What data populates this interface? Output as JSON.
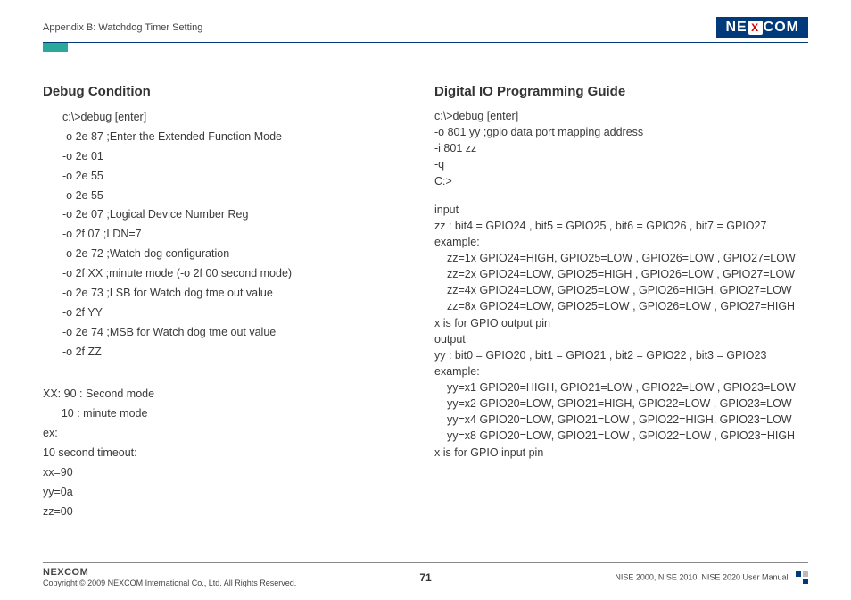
{
  "header": {
    "appendix": "Appendix B: Watchdog Timer Setting",
    "logo_pre": "NE",
    "logo_x": "X",
    "logo_post": "COM"
  },
  "left": {
    "title": "Debug Condition",
    "lines": [
      "c:\\>debug [enter]",
      "-o 2e 87 ;Enter the Extended Function Mode",
      "-o 2e 01",
      "-o 2e 55",
      "-o 2e 55",
      "-o 2e 07 ;Logical Device Number Reg",
      "-o 2f 07 ;LDN=7",
      "-o 2e 72 ;Watch dog configuration",
      "-o 2f XX ;minute mode (-o 2f 00 second mode)",
      "-o 2e 73 ;LSB for Watch dog tme out value",
      "-o 2f YY",
      "-o 2e 74 ;MSB for Watch dog tme out value",
      "-o 2f ZZ"
    ],
    "notes": [
      "XX: 90 : Second mode",
      "      10 : minute mode",
      "ex:",
      "10 second timeout:",
      "xx=90",
      "yy=0a",
      "zz=00"
    ]
  },
  "right": {
    "title": "Digital IO Programming Guide",
    "lines1": [
      "c:\\>debug [enter]",
      "-o 801 yy ;gpio data port mapping address",
      "-i 801 zz",
      "-q",
      "C:>"
    ],
    "input_label": "input",
    "zz_def": "zz : bit4 = GPIO24 , bit5 = GPIO25 , bit6 = GPIO26 , bit7 = GPIO27",
    "example_label": "example:",
    "zz_examples": [
      "zz=1x  GPIO24=HIGH, GPIO25=LOW , GPIO26=LOW , GPIO27=LOW",
      "zz=2x  GPIO24=LOW, GPIO25=HIGH , GPIO26=LOW , GPIO27=LOW",
      "zz=4x  GPIO24=LOW, GPIO25=LOW , GPIO26=HIGH, GPIO27=LOW",
      "zz=8x  GPIO24=LOW, GPIO25=LOW , GPIO26=LOW , GPIO27=HIGH"
    ],
    "x_out": "x is for GPIO output pin",
    "output_label": "output",
    "yy_def": "yy : bit0 = GPIO20 , bit1 = GPIO21 , bit2 = GPIO22 , bit3 = GPIO23",
    "yy_examples": [
      "yy=x1  GPIO20=HIGH, GPIO21=LOW , GPIO22=LOW , GPIO23=LOW",
      "yy=x2  GPIO20=LOW, GPIO21=HIGH, GPIO22=LOW , GPIO23=LOW",
      "yy=x4  GPIO20=LOW, GPIO21=LOW , GPIO22=HIGH, GPIO23=LOW",
      "yy=x8  GPIO20=LOW, GPIO21=LOW , GPIO22=LOW , GPIO23=HIGH"
    ],
    "x_in": "x is for GPIO input pin"
  },
  "footer": {
    "logo": "NEXCOM",
    "copyright": "Copyright © 2009 NEXCOM International Co., Ltd. All Rights Reserved.",
    "page": "71",
    "manual": "NISE 2000, NISE 2010, NISE 2020 User Manual"
  }
}
